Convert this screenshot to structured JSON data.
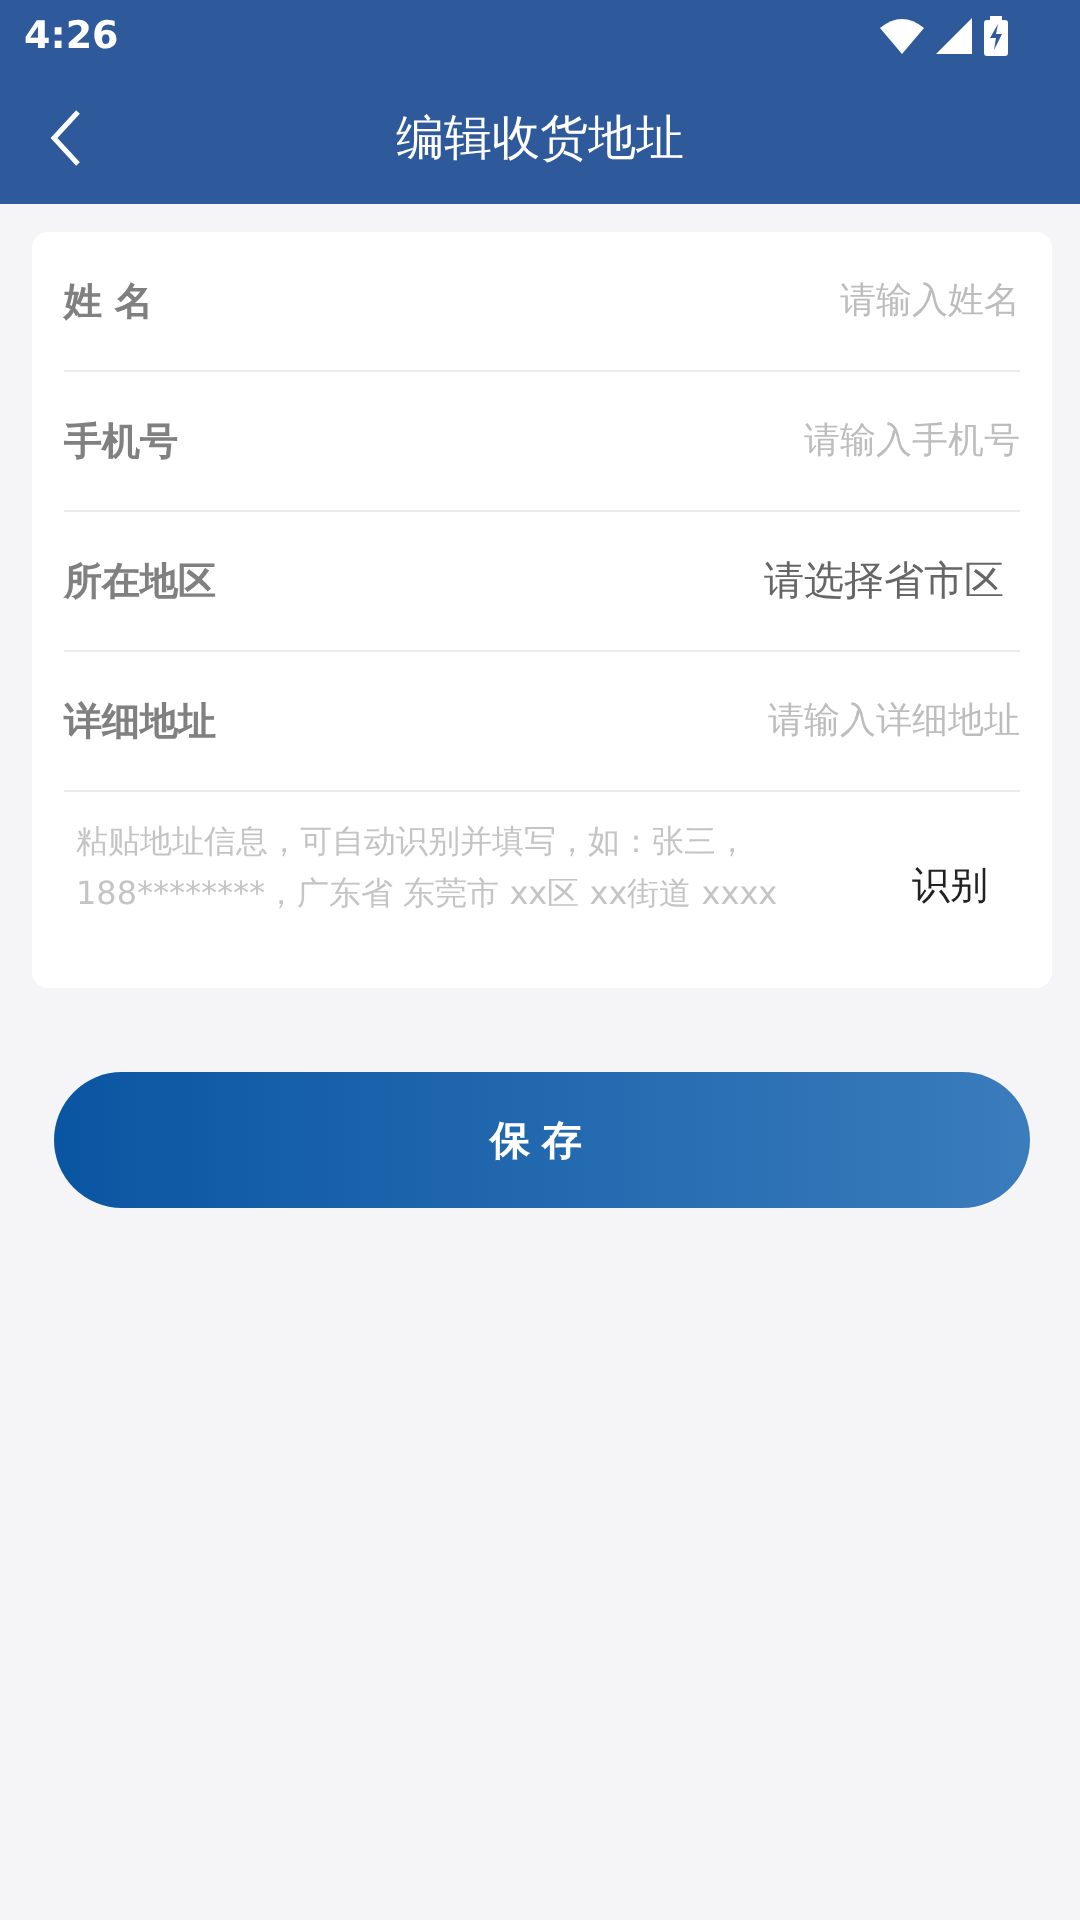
{
  "status_bar": {
    "time": "4:26"
  },
  "header": {
    "title": "编辑收货地址"
  },
  "fields": [
    {
      "kind": "input",
      "label": "姓 名",
      "placeholder": "请输入姓名"
    },
    {
      "kind": "input",
      "label": "手机号",
      "placeholder": "请输入手机号"
    },
    {
      "kind": "select",
      "label": "所在地区",
      "value": "请选择省市区"
    },
    {
      "kind": "input",
      "label": "详细地址",
      "placeholder": "请输入详细地址"
    }
  ],
  "paste": {
    "placeholder": "粘贴地址信息，可自动识别并填写，如：张三，188********，广东省 东莞市 xx区 xx街道 xxxx",
    "button": "识别"
  },
  "save_button": "保存"
}
